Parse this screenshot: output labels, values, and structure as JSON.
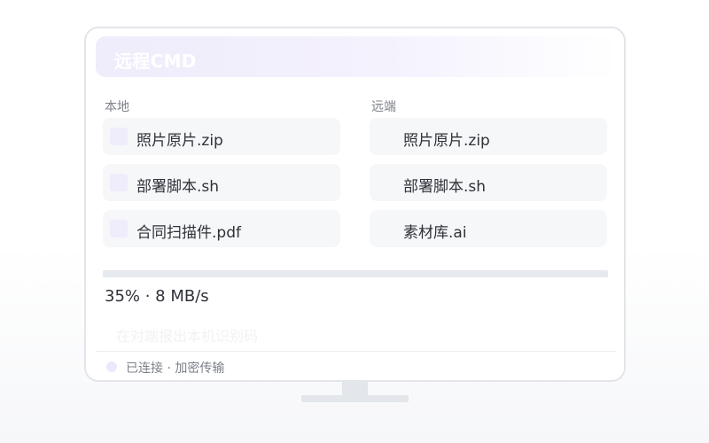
{
  "window": {
    "title": "远程CMD"
  },
  "local": {
    "label": "本地",
    "files": [
      "照片原片.zip",
      "部署脚本.sh",
      "合同扫描件.pdf"
    ]
  },
  "remote": {
    "label": "远端",
    "files": [
      "照片原片.zip",
      "部署脚本.sh",
      "素材库.ai"
    ]
  },
  "transfer": {
    "progress_percent": 35,
    "speed_text": "35% · 8 MB/s"
  },
  "hint": "在对端报出本机识别码",
  "status": {
    "text": "已连接 · 加密传输"
  },
  "colors": {
    "accent": "#ebe8fb",
    "track": "#e6e9ee"
  }
}
